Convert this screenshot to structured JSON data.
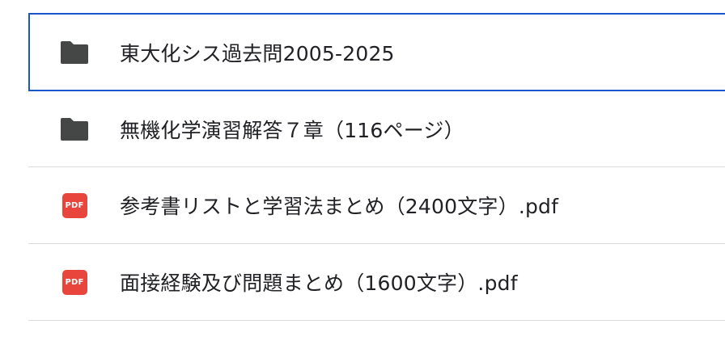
{
  "files": [
    {
      "name": "東大化シス過去問2005-2025",
      "type": "folder",
      "icon": "folder-icon",
      "selected": true
    },
    {
      "name": "無機化学演習解答７章（116ページ）",
      "type": "folder",
      "icon": "folder-icon",
      "selected": false
    },
    {
      "name": "参考書リストと学習法まとめ（2400文字）.pdf",
      "type": "pdf",
      "icon": "pdf-icon",
      "icon_label": "PDF",
      "selected": false
    },
    {
      "name": "面接経験及び問題まとめ（1600文字）.pdf",
      "type": "pdf",
      "icon": "pdf-icon",
      "icon_label": "PDF",
      "selected": false
    }
  ],
  "colors": {
    "selection_border": "#1a56c9",
    "folder": "#444746",
    "pdf": "#e8453c",
    "text": "#202124",
    "divider": "#dadce0"
  }
}
